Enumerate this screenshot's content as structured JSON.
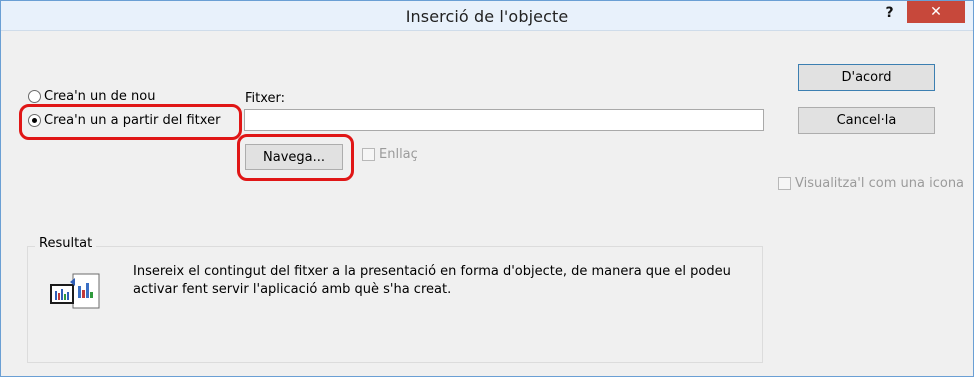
{
  "window": {
    "title": "Inserció de l'objecte",
    "help_label": "?",
    "close_label": "✕"
  },
  "options": {
    "create_new_label": "Crea'n un de nou",
    "create_from_file_label": "Crea'n un a partir del fitxer",
    "selected": "create_from_file"
  },
  "file": {
    "label": "Fitxer:",
    "value": "",
    "browse_label": "Navega...",
    "link_label": "Enllaç",
    "link_checked": false
  },
  "buttons": {
    "ok_label": "D'acord",
    "cancel_label": "Cancel·la"
  },
  "display_as_icon": {
    "label": "Visualitza'l com una icona",
    "checked": false
  },
  "result": {
    "title": "Resultat",
    "text": "Insereix el contingut del fitxer a la presentació en forma d'objecte, de manera que el podeu activar fent servir l'aplicació amb què s'ha creat."
  },
  "colors": {
    "highlight": "#e01616",
    "close_button": "#c7483b",
    "titlebar": "#e8f1fb"
  },
  "icons": {
    "help": "question-mark-icon",
    "close": "close-icon",
    "result": "embedded-chart-file-icon"
  }
}
